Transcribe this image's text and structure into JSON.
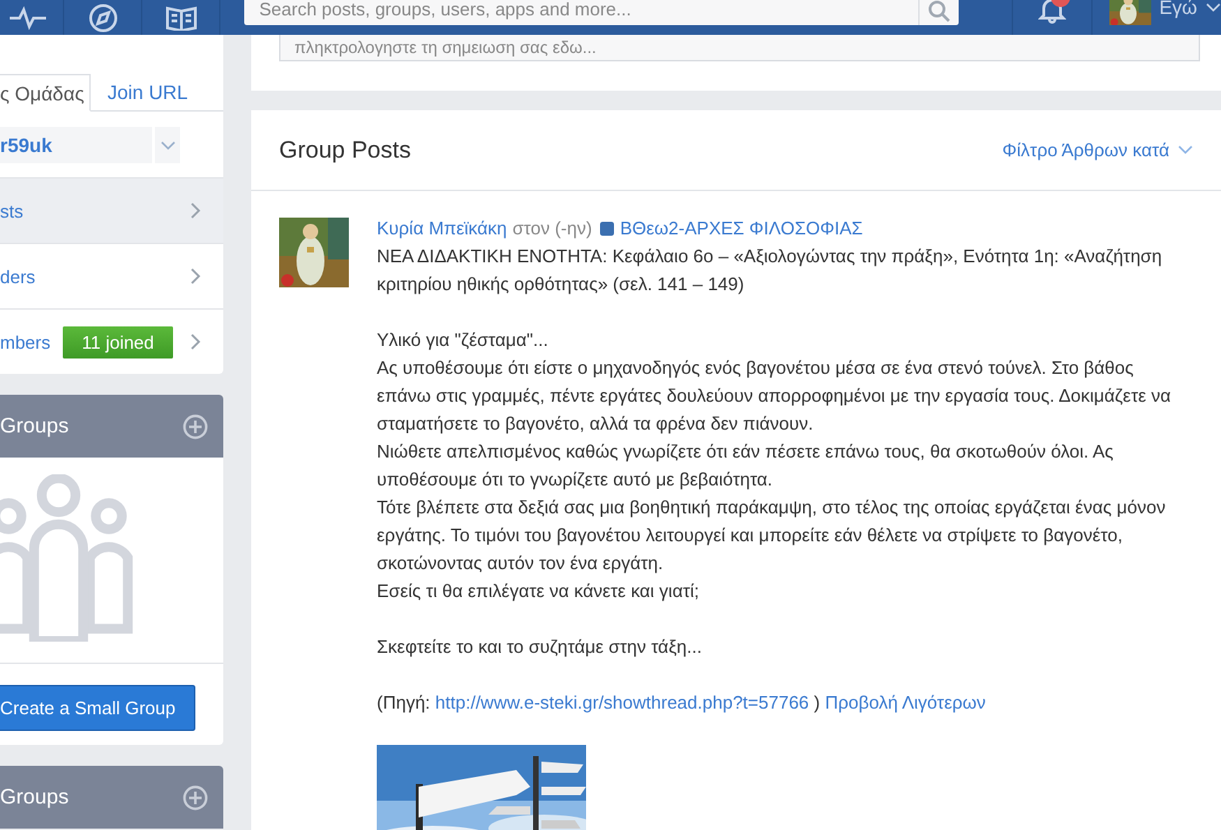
{
  "navbar": {
    "search": {
      "placeholder": "Search posts, groups, users, apps and more..."
    },
    "notifications": {
      "unread": true
    },
    "user": {
      "label": "Εγώ"
    }
  },
  "sidebar": {
    "tabs": [
      {
        "label": "ς Ομάδας",
        "selected": true
      },
      {
        "label": "Join URL",
        "selected": false
      }
    ],
    "code": "r59uk",
    "links": [
      {
        "label": "sts",
        "selected": true
      },
      {
        "label": "ders",
        "selected": false
      },
      {
        "label": "mbers",
        "selected": false,
        "badge": "11 joined"
      }
    ],
    "panels": [
      {
        "title": "Groups",
        "empty": true,
        "button": "Create a Small Group"
      },
      {
        "title": "Groups",
        "empty": false
      }
    ]
  },
  "main": {
    "note": {
      "placeholder": "πληκτρολογηστε τη σημειωση σας εδω..."
    },
    "feed": {
      "title": "Group Posts",
      "filter": "Φίλτρο Άρθρων κατά"
    },
    "posts": [
      {
        "author": "Κυρία Μπεϊκάκη",
        "context": "στον (-ην)",
        "group": "ΒΘεω2-ΑΡΧΕΣ ΦΙΛΟΣΟΦΙΑΣ",
        "body": [
          [
            "ΝΕΑ ΔΙΔΑΚΤΙΚΗ ΕΝΟΤΗΤΑ: Κεφάλαιο 6ο – «Αξιολογώντας την πράξη», Ενότητα 1η: «Αναζήτηση κριτηρίου ηθικής ορθότητας» (σελ. 141 – 149)"
          ],
          [
            "Υλικό για \"ζέσταμα\"...",
            "Ας υποθέσουμε ότι είστε ο μηχανοδηγός ενός βαγονέτου μέσα σε ένα στενό τούνελ. Στο βάθος επάνω στις γραμμές, πέντε εργάτες δουλεύουν απορροφημένοι με την εργασία τους. Δοκιμάζετε να σταματήσετε το βαγονέτο, αλλά τα φρένα δεν πιάνουν.",
            "Νιώθετε απελπισμένος καθώς γνωρίζετε ότι εάν πέσετε επάνω τους, θα σκοτωθούν όλοι. Ας υποθέσουμε ότι το γνωρίζετε αυτό με βεβαιότητα.",
            "Τότε βλέπετε στα δεξιά σας μια βοηθητική παράκαμψη, στο τέλος της οποίας εργάζεται ένας μόνον εργάτης. Το τιμόνι του βαγονέτου λειτουργεί και μπορείτε εάν θέλετε να στρίψετε το βαγονέτο, σκοτώνοντας αυτόν τον ένα εργάτη.",
            "Εσείς τι θα επιλέγατε να κάνετε και γιατί;"
          ],
          [
            "Σκεφτείτε το και το συζητάμε στην τάξη..."
          ]
        ],
        "source": {
          "prefix": "(Πηγή:",
          "url": "http://www.e-steki.gr/showthread.php?t=57766",
          "suffix": ")",
          "toggle": "Προβολή Λιγότερων"
        },
        "attachment": {
          "kind": "picture"
        }
      }
    ]
  }
}
